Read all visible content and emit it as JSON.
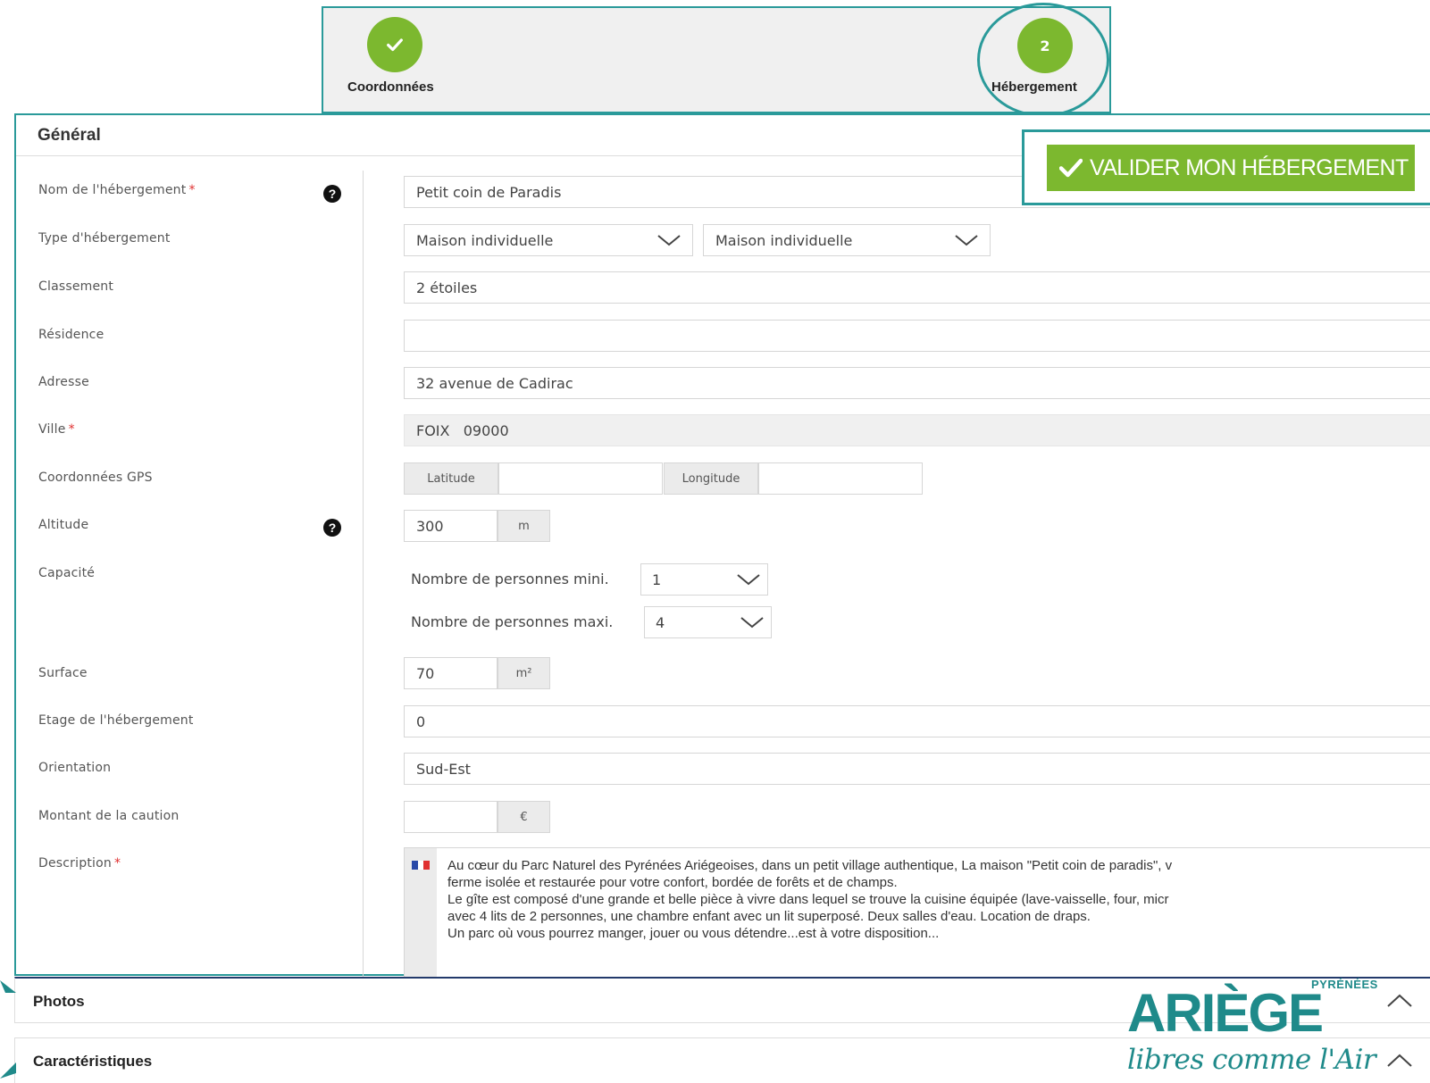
{
  "stepper": {
    "step1": {
      "label": "Coordonnées",
      "state": "completed"
    },
    "step2": {
      "number": "2",
      "label": "Hébergement",
      "state": "active"
    }
  },
  "general": {
    "title": "Général",
    "validate_button": "VALIDER MON HÉBERGEMENT",
    "fields": {
      "nom": {
        "label": "Nom de l'hébergement",
        "value": "Petit coin de Paradis"
      },
      "type": {
        "label": "Type d'hébergement",
        "value1": "Maison individuelle",
        "value2": "Maison individuelle"
      },
      "classement": {
        "label": "Classement",
        "value": "2 étoiles"
      },
      "residence": {
        "label": "Résidence",
        "value": ""
      },
      "adresse": {
        "label": "Adresse",
        "value": "32 avenue de Cadirac"
      },
      "ville": {
        "label": "Ville",
        "value": "FOIX   09000"
      },
      "gps": {
        "label": "Coordonnées GPS",
        "latitude_label": "Latitude",
        "longitude_label": "Longitude",
        "latitude": "",
        "longitude": ""
      },
      "altitude": {
        "label": "Altitude",
        "value": "300",
        "unit": "m"
      },
      "capacite": {
        "label": "Capacité",
        "mini_label": "Nombre de personnes mini.",
        "mini_value": "1",
        "maxi_label": "Nombre de personnes maxi.",
        "maxi_value": "4"
      },
      "surface": {
        "label": "Surface",
        "value": "70",
        "unit": "m²"
      },
      "etage": {
        "label": "Etage de l'hébergement",
        "value": "0"
      },
      "orientation": {
        "label": "Orientation",
        "value": "Sud-Est"
      },
      "caution": {
        "label": "Montant de la caution",
        "value": "",
        "unit": "€"
      },
      "description": {
        "label": "Description",
        "lines": [
          "Au cœur du Parc Naturel des Pyrénées Ariégeoises, dans un petit village authentique, La maison \"Petit coin de paradis\", v",
          "ferme isolée et restaurée pour votre confort, bordée de forêts et de champs.",
          "Le gîte est composé d'une grande et belle pièce à vivre dans lequel se trouve la cuisine équipée (lave-vaisselle, four, micr",
          "avec 4 lits de 2 personnes, une chambre enfant avec un lit superposé. Deux salles d'eau. Location de draps.",
          "Un parc où vous pourrez manger, jouer ou vous détendre...est à votre disposition..."
        ]
      }
    }
  },
  "sections": {
    "photos": "Photos",
    "caracteristiques": "Caractéristiques"
  },
  "logo": {
    "small": "PYRÉNÉES",
    "main": "ARIÈGE",
    "tagline": "libres comme l'Air"
  },
  "colors": {
    "accent_green": "#7cb82f",
    "highlight_teal": "#2a9a9a",
    "logo_teal": "#1f8a8a",
    "required_red": "#e03030"
  }
}
